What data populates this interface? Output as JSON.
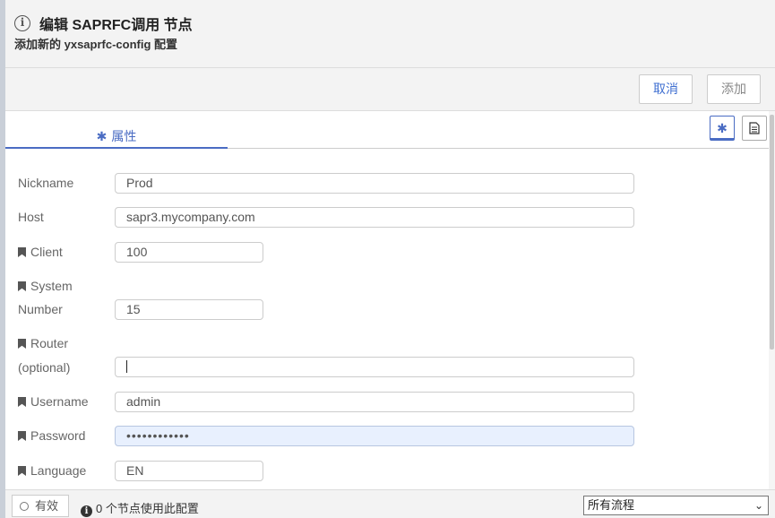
{
  "header": {
    "title": "编辑 SAPRFC调用 节点",
    "subtitle": "添加新的 yxsaprfc-config 配置"
  },
  "toolbar": {
    "cancel_label": "取消",
    "add_label": "添加"
  },
  "tabs": {
    "properties_label": "属性"
  },
  "form": {
    "nickname": {
      "label": "Nickname",
      "value": "Prod"
    },
    "host": {
      "label": "Host",
      "value": "sapr3.mycompany.com"
    },
    "client": {
      "label": "Client",
      "value": "100"
    },
    "system_number": {
      "label_line1": "System",
      "label_line2": "Number",
      "value": "15"
    },
    "router": {
      "label_line1": "Router",
      "label_line2": "(optional)",
      "value": ""
    },
    "username": {
      "label": "Username",
      "value": "admin"
    },
    "password": {
      "label": "Password",
      "value": "••••••••••••"
    },
    "language": {
      "label": "Language",
      "value": "EN"
    }
  },
  "footer": {
    "valid_label": "有效",
    "usage_text": "0 个节点使用此配置",
    "scope_selected": "所有流程"
  },
  "colors": {
    "accent": "#4a6cc3",
    "cancel_text": "#3f6fd1",
    "password_bg": "#e8f0fe"
  },
  "icons": [
    "info-icon",
    "gear-icon",
    "document-icon",
    "bookmark-icon",
    "circle-icon",
    "chevron-down-icon"
  ]
}
